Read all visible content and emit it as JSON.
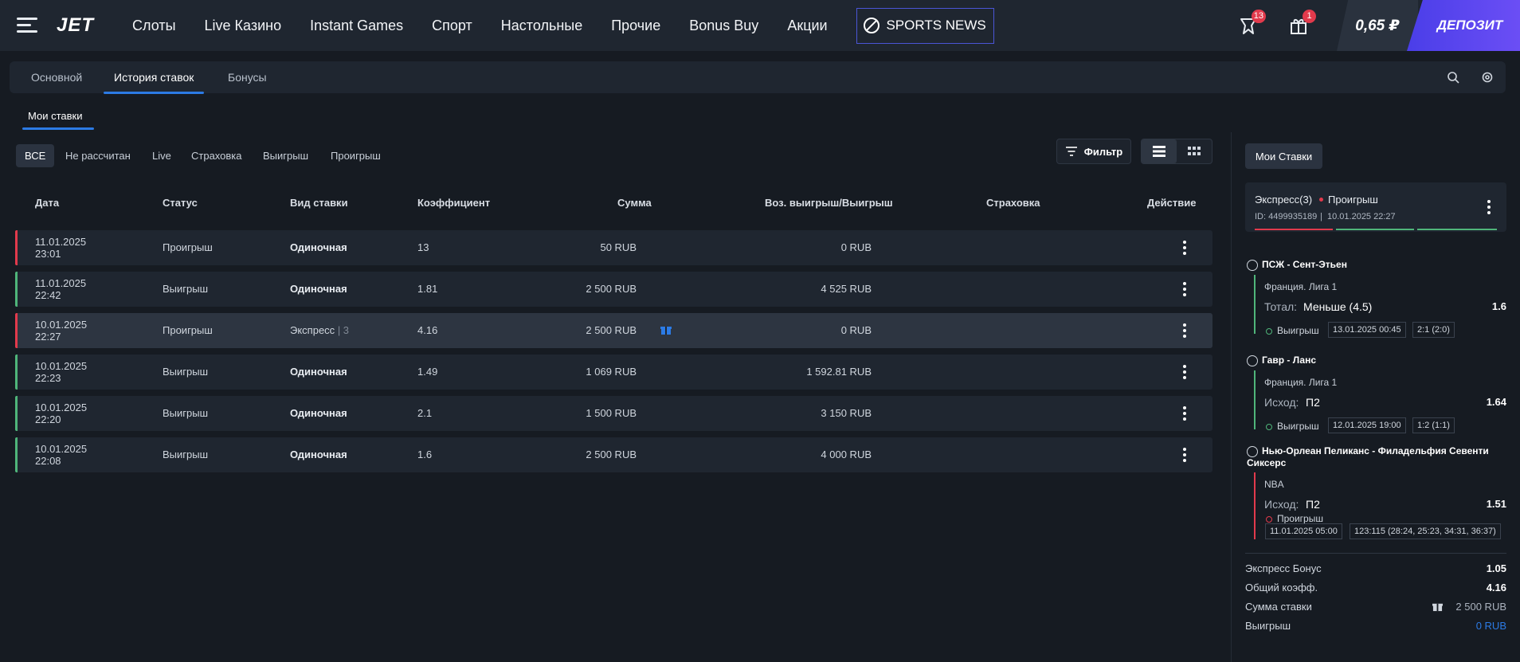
{
  "header": {
    "logo": "JET",
    "nav": [
      "Слоты",
      "Live Казино",
      "Instant Games",
      "Спорт",
      "Настольные",
      "Прочие",
      "Bonus Buy",
      "Акции"
    ],
    "sports_news": "SPORTS NEWS",
    "notifications_badge": "13",
    "gifts_badge": "1",
    "balance": "0,65 ₽",
    "deposit": "ДЕПОЗИТ"
  },
  "subtabs": [
    "Основной",
    "История ставок",
    "Бонусы"
  ],
  "my_bets_tab": "Мои ставки",
  "filters": [
    "ВСЕ",
    "Не рассчитан",
    "Live",
    "Страховка",
    "Выигрыш",
    "Проигрыш"
  ],
  "filter_button": "Фильтр",
  "columns": [
    "Дата",
    "Статус",
    "Вид ставки",
    "Коэффициент",
    "Сумма",
    "Воз. выигрыш/Выигрыш",
    "Страховка",
    "Действие"
  ],
  "rows": [
    {
      "date": "11.01.2025",
      "time": "23:01",
      "status": "Проигрыш",
      "type": "Одиночная",
      "type_extra": "",
      "coef": "13",
      "sum": "50 RUB",
      "payout": "0 RUB",
      "result": "loss"
    },
    {
      "date": "11.01.2025",
      "time": "22:42",
      "status": "Выигрыш",
      "type": "Одиночная",
      "type_extra": "",
      "coef": "1.81",
      "sum": "2 500 RUB",
      "payout": "4 525 RUB",
      "result": "win"
    },
    {
      "date": "10.01.2025",
      "time": "22:27",
      "status": "Проигрыш",
      "type": "Экспресс",
      "type_extra": "| 3",
      "coef": "4.16",
      "sum": "2 500 RUB",
      "payout": "0 RUB",
      "result": "loss"
    },
    {
      "date": "10.01.2025",
      "time": "22:23",
      "status": "Выигрыш",
      "type": "Одиночная",
      "type_extra": "",
      "coef": "1.49",
      "sum": "1 069 RUB",
      "payout": "1 592.81 RUB",
      "result": "win"
    },
    {
      "date": "10.01.2025",
      "time": "22:20",
      "status": "Выигрыш",
      "type": "Одиночная",
      "type_extra": "",
      "coef": "2.1",
      "sum": "1 500 RUB",
      "payout": "3 150 RUB",
      "result": "win"
    },
    {
      "date": "10.01.2025",
      "time": "22:08",
      "status": "Выигрыш",
      "type": "Одиночная",
      "type_extra": "",
      "coef": "1.6",
      "sum": "2 500 RUB",
      "payout": "4 000 RUB",
      "result": "win"
    }
  ],
  "panel": {
    "title": "Мои Ставки",
    "card": {
      "type": "Экспресс(3)",
      "status": "Проигрыш",
      "id": "ID: 4499935189",
      "sep": "|",
      "datetime": "10.01.2025 22:27"
    },
    "events": [
      {
        "name": "ПСЖ - Сент-Этьен",
        "league": "Франция. Лига 1",
        "market": "Тотал:",
        "pick": "Меньше (4.5)",
        "odds": "1.6",
        "result": "Выигрыш",
        "date": "13.01.2025 00:45",
        "score": "2:1 (2:0)"
      },
      {
        "name": "Гавр - Ланс",
        "league": "Франция. Лига 1",
        "market": "Исход:",
        "pick": "П2",
        "odds": "1.64",
        "result": "Выигрыш",
        "date": "12.01.2025 19:00",
        "score": "1:2 (1:1)"
      },
      {
        "name": "Нью-Орлеан Пеликанс - Филадельфия Севенти Сиксерс",
        "league": "NBA",
        "market": "Исход:",
        "pick": "П2",
        "odds": "1.51",
        "result": "Проигрыш",
        "date": "11.01.2025 05:00",
        "score": "123:115 (28:24, 25:23, 34:31, 36:37)"
      }
    ],
    "summary": [
      {
        "label": "Экспресс Бонус",
        "value": "1.05"
      },
      {
        "label": "Общий коэфф.",
        "value": "4.16"
      },
      {
        "label": "Сумма ставки",
        "value": "2 500 RUB"
      },
      {
        "label": "Выигрыш",
        "value": "0 RUB"
      }
    ]
  },
  "colors": {
    "win": "#4fb57a",
    "loss": "#e23a4c",
    "accent": "#2c7be5",
    "deposit": "#5a45f0"
  }
}
